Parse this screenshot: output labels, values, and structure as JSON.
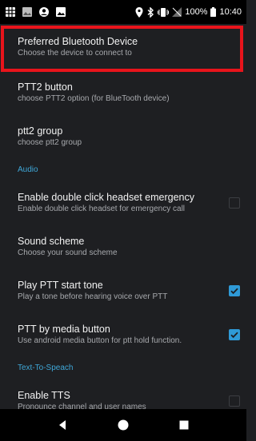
{
  "status_bar": {
    "battery_percent": "100%",
    "time": "10:40",
    "left_icons": [
      "app-grid-icon",
      "image-icon",
      "profile-icon",
      "gallery-icon"
    ],
    "right_icons": [
      "location-icon",
      "bluetooth-icon",
      "vibrate-icon",
      "no-signal-icon",
      "battery-icon"
    ]
  },
  "preferences": {
    "preferred_bt": {
      "title": "Preferred Bluetooth Device",
      "summary": "Choose the device to connect to"
    },
    "ptt2_button": {
      "title": "PTT2 button",
      "summary": "choose PTT2 option (for BlueTooth device)"
    },
    "ptt2_group": {
      "title": "ptt2 group",
      "summary": "choose ptt2 group"
    },
    "audio_category": "Audio",
    "double_click": {
      "title": "Enable double click headset emergency",
      "summary": "Enable double click headset for emergency call",
      "checked": false
    },
    "sound_scheme": {
      "title": "Sound scheme",
      "summary": "Choose your sound scheme"
    },
    "ptt_start_tone": {
      "title": "Play PTT start tone",
      "summary": "Play a tone before hearing voice over PTT",
      "checked": true
    },
    "ptt_media_button": {
      "title": "PTT by media button",
      "summary": "Use android media button for ptt hold function.",
      "checked": true
    },
    "tts_category": "Text-To-Speach",
    "enable_tts": {
      "title": "Enable TTS",
      "summary": "Pronounce channel and user names",
      "checked": false
    }
  },
  "colors": {
    "background": "#1e1f22",
    "accent": "#3fa7d8",
    "checkbox_on": "#2f9ad7",
    "highlight": "#e8141b"
  },
  "nav_bar": {
    "icons": [
      "back-icon",
      "home-icon",
      "recents-icon"
    ]
  }
}
